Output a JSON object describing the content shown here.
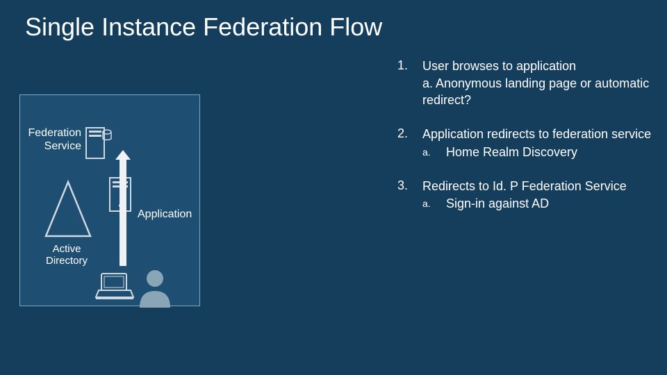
{
  "title": "Single Instance Federation Flow",
  "labels": {
    "federation_service": "Federation Service",
    "application": "Application",
    "active_directory": "Active Directory"
  },
  "steps": [
    {
      "num": "1.",
      "text": "User browses to application",
      "sub_inline": "a. Anonymous landing page or automatic redirect?"
    },
    {
      "num": "2.",
      "text": "Application redirects to federation service",
      "sub_letter": "a.",
      "sub_text": "Home Realm Discovery"
    },
    {
      "num": "3.",
      "text": "Redirects to Id. P Federation Service",
      "sub_letter": "a.",
      "sub_text": "Sign-in against AD"
    }
  ]
}
